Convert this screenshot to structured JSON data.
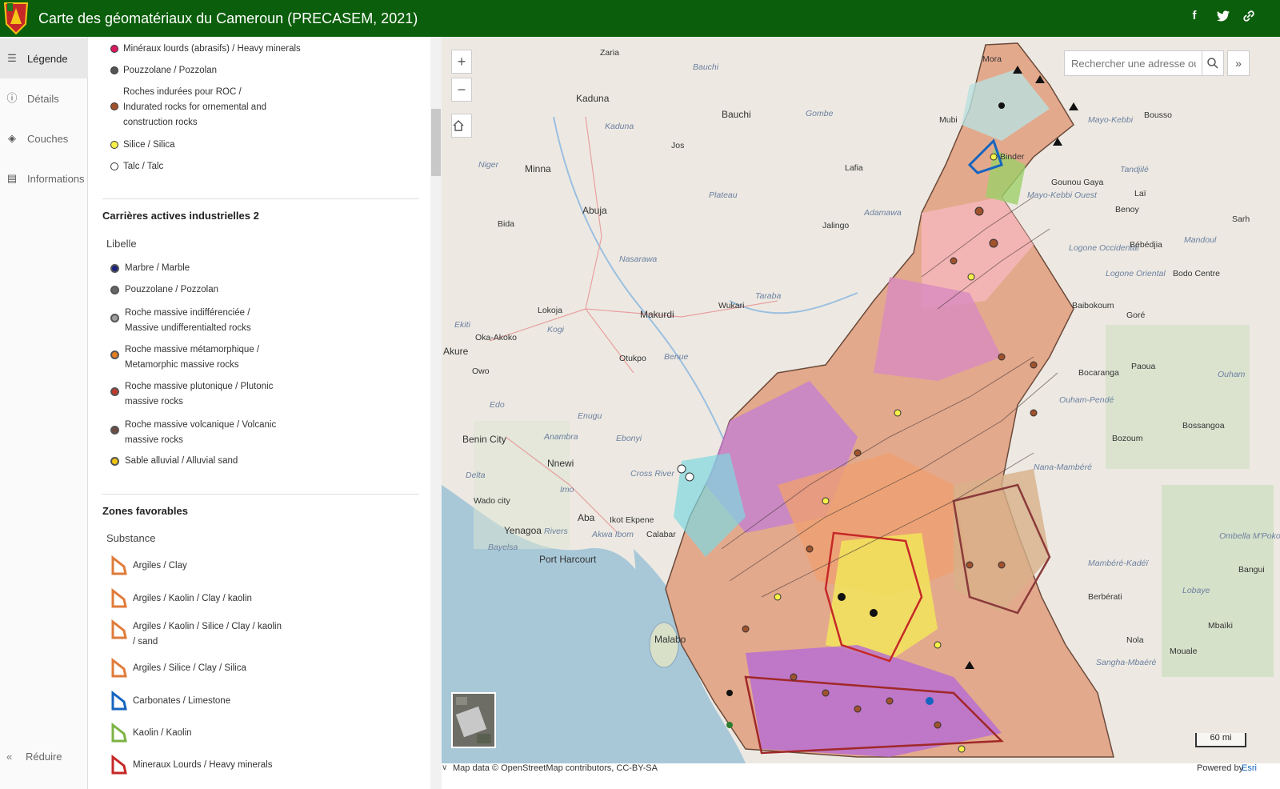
{
  "header": {
    "title": "Carte des géomatériaux du Cameroun (PRECASEM, 2021)",
    "icons": [
      "facebook-icon",
      "twitter-icon",
      "link-icon"
    ],
    "bg_color": "#0b5e0b"
  },
  "nav": {
    "items": [
      {
        "label": "Légende",
        "icon": "legend-icon",
        "active": true
      },
      {
        "label": "Détails",
        "icon": "info-icon",
        "active": false
      },
      {
        "label": "Couches",
        "icon": "layers-icon",
        "active": false
      },
      {
        "label": "Informations",
        "icon": "doc-icon",
        "active": false
      }
    ],
    "collapse_label": "Réduire"
  },
  "legend": {
    "top_items": [
      {
        "label": "Minéraux lourds (abrasifs) / Heavy minerals",
        "color": "#d81b60"
      },
      {
        "label": "Pouzzolane / Pozzolan",
        "color": "#555555"
      },
      {
        "label": "Roches indurées pour ROC / Indurated rocks for ornemental and construction rocks",
        "color": "#a0522d"
      },
      {
        "label": "Silice / Silica",
        "color": "#f5f04a"
      },
      {
        "label": "Talc / Talc",
        "color": "#ffffff"
      }
    ],
    "quarries": {
      "title": "Carrières actives industrielles 2",
      "subtitle": "Libelle",
      "items": [
        {
          "label": "Marbre / Marble",
          "color": "#1a237e"
        },
        {
          "label": "Pouzzolane / Pozzolan",
          "color": "#666666"
        },
        {
          "label": "Roche massive indifférenciée / Massive undifferentialted rocks",
          "color": "#9e9e9e"
        },
        {
          "label": "Roche massive métamorphique / Metamorphic massive rocks",
          "color": "#e67e22"
        },
        {
          "label": "Roche massive plutonique / Plutonic massive rocks",
          "color": "#c0392b"
        },
        {
          "label": "Roche massive volcanique / Volcanic massive rocks",
          "color": "#6d4c41"
        },
        {
          "label": "Sable alluvial / Alluvial sand",
          "color": "#f1c40f"
        }
      ]
    },
    "zones": {
      "title": "Zones favorables",
      "subtitle": "Substance",
      "items": [
        {
          "label": "Argiles / Clay",
          "color": "#e07b39"
        },
        {
          "label": "Argiles / Kaolin / Clay / kaolin",
          "color": "#e07b39"
        },
        {
          "label": "Argiles / Kaolin / Silice / Clay / kaolin / sand",
          "color": "#e07b39"
        },
        {
          "label": "Argiles / Silice / Clay / Silica",
          "color": "#e07b39"
        },
        {
          "label": "Carbonates / Limestone",
          "color": "#1565c0"
        },
        {
          "label": "Kaolin / Kaolin",
          "color": "#7cb342"
        },
        {
          "label": "Mineraux Lourds / Heavy minerals",
          "color": "#c62828"
        }
      ]
    }
  },
  "map": {
    "search_placeholder": "Rechercher une adresse ou un",
    "scale_label": "60 mi",
    "attribution": "Map data © OpenStreetMap contributors, CC-BY-SA",
    "powered_by": "Powered by",
    "powered_by_brand": "Esri",
    "zoom_in": "+",
    "zoom_out": "−",
    "place_labels": [
      {
        "text": "Zaria",
        "style": "city"
      },
      {
        "text": "Bauchi",
        "style": "region"
      },
      {
        "text": "Kaduna",
        "style": "city"
      },
      {
        "text": "Kaduna",
        "style": "region"
      },
      {
        "text": "Bauchi",
        "style": "city"
      },
      {
        "text": "Gombe",
        "style": "region"
      },
      {
        "text": "Mora",
        "style": "city"
      },
      {
        "text": "Jos",
        "style": "city"
      },
      {
        "text": "Mubi",
        "style": "city"
      },
      {
        "text": "Mayo-Kebbi",
        "style": "region"
      },
      {
        "text": "Bousso",
        "style": "city"
      },
      {
        "text": "Niger",
        "style": "region"
      },
      {
        "text": "Minna",
        "style": "city"
      },
      {
        "text": "Lafia",
        "style": "city"
      },
      {
        "text": "Binder",
        "style": "city"
      },
      {
        "text": "Tandjilé",
        "style": "region"
      },
      {
        "text": "Plateau",
        "style": "region"
      },
      {
        "text": "Gounou Gaya",
        "style": "city"
      },
      {
        "text": "Laï",
        "style": "city"
      },
      {
        "text": "Abuja",
        "style": "city"
      },
      {
        "text": "Adamawa",
        "style": "region"
      },
      {
        "text": "Mayo-Kebbi Ouest",
        "style": "region"
      },
      {
        "text": "Bida",
        "style": "city"
      },
      {
        "text": "Jalingo",
        "style": "city"
      },
      {
        "text": "Benoy",
        "style": "city"
      },
      {
        "text": "Sarh",
        "style": "city"
      },
      {
        "text": "Nasarawa",
        "style": "region"
      },
      {
        "text": "Logone Occidental",
        "style": "region"
      },
      {
        "text": "Bébédjia",
        "style": "city"
      },
      {
        "text": "Mandoul",
        "style": "region"
      },
      {
        "text": "Logone Oriental",
        "style": "region"
      },
      {
        "text": "Bodo Centre",
        "style": "city"
      },
      {
        "text": "Taraba",
        "style": "region"
      },
      {
        "text": "Lokoja",
        "style": "city"
      },
      {
        "text": "Wukari",
        "style": "city"
      },
      {
        "text": "Makurdi",
        "style": "city"
      },
      {
        "text": "Baibokoum",
        "style": "city"
      },
      {
        "text": "Goré",
        "style": "city"
      },
      {
        "text": "Ekiti",
        "style": "region"
      },
      {
        "text": "Kogi",
        "style": "region"
      },
      {
        "text": "Oka-Akoko",
        "style": "city"
      },
      {
        "text": "Akure",
        "style": "city"
      },
      {
        "text": "Otukpo",
        "style": "city"
      },
      {
        "text": "Benue",
        "style": "region"
      },
      {
        "text": "Owo",
        "style": "city"
      },
      {
        "text": "Bocaranga",
        "style": "city"
      },
      {
        "text": "Paoua",
        "style": "city"
      },
      {
        "text": "Ouham",
        "style": "region"
      },
      {
        "text": "Edo",
        "style": "region"
      },
      {
        "text": "Ouham-Pendé",
        "style": "region"
      },
      {
        "text": "Enugu",
        "style": "region"
      },
      {
        "text": "Bossangoa",
        "style": "city"
      },
      {
        "text": "Benin City",
        "style": "city"
      },
      {
        "text": "Anambra",
        "style": "region"
      },
      {
        "text": "Ebonyi",
        "style": "region"
      },
      {
        "text": "Bozoum",
        "style": "city"
      },
      {
        "text": "Nnewi",
        "style": "city"
      },
      {
        "text": "Nana-Mambéré",
        "style": "region"
      },
      {
        "text": "Delta",
        "style": "region"
      },
      {
        "text": "Cross River",
        "style": "region"
      },
      {
        "text": "Imo",
        "style": "region"
      },
      {
        "text": "Wado city",
        "style": "city"
      },
      {
        "text": "Aba",
        "style": "city"
      },
      {
        "text": "Ikot Ekpene",
        "style": "city"
      },
      {
        "text": "Yenagoa",
        "style": "city"
      },
      {
        "text": "Rivers",
        "style": "region"
      },
      {
        "text": "Akwa Ibom",
        "style": "region"
      },
      {
        "text": "Calabar",
        "style": "city"
      },
      {
        "text": "Ombella M'Poko",
        "style": "region"
      },
      {
        "text": "Bayelsa",
        "style": "region"
      },
      {
        "text": "Port Harcourt",
        "style": "city"
      },
      {
        "text": "Mambéré-Kadéï",
        "style": "region"
      },
      {
        "text": "Bangui",
        "style": "city"
      },
      {
        "text": "Berbérati",
        "style": "city"
      },
      {
        "text": "Lobaye",
        "style": "region"
      },
      {
        "text": "Mbaïki",
        "style": "city"
      },
      {
        "text": "Malabo",
        "style": "city"
      },
      {
        "text": "Nola",
        "style": "city"
      },
      {
        "text": "Sangha-Mbaéré",
        "style": "region"
      },
      {
        "text": "Mouale",
        "style": "city"
      }
    ]
  }
}
